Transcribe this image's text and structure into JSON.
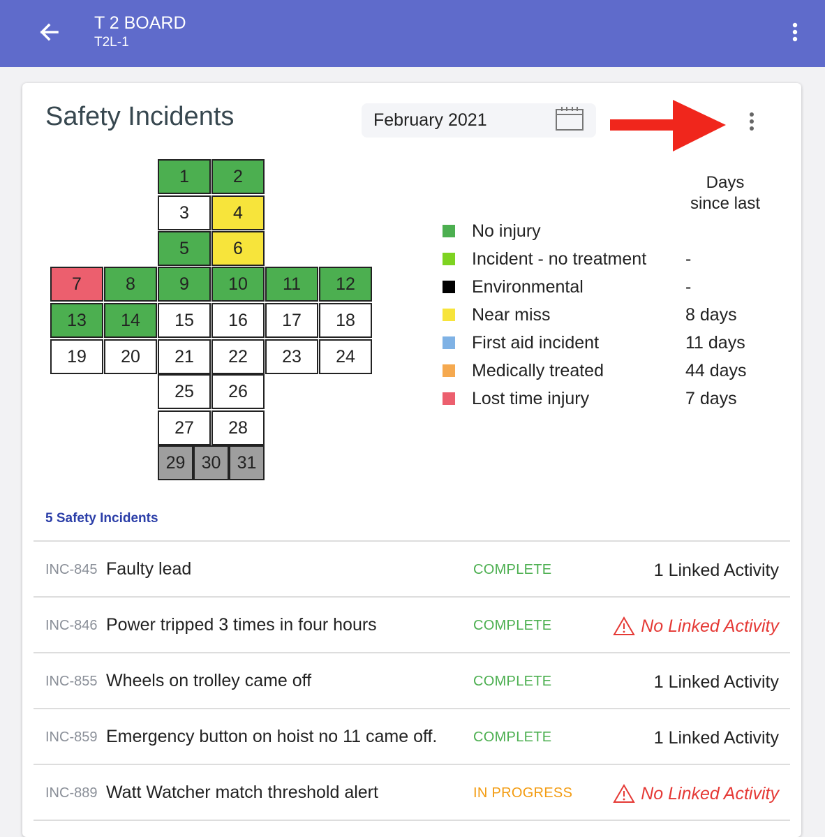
{
  "appbar": {
    "title": "T 2 BOARD",
    "subtitle": "T2L-1"
  },
  "card": {
    "title": "Safety Incidents",
    "date": "February 2021"
  },
  "calendar": {
    "days": [
      {
        "day": "1",
        "category": "no-injury"
      },
      {
        "day": "2",
        "category": "no-injury"
      },
      {
        "day": "3",
        "category": "none"
      },
      {
        "day": "4",
        "category": "near-miss"
      },
      {
        "day": "5",
        "category": "no-injury"
      },
      {
        "day": "6",
        "category": "near-miss"
      },
      {
        "day": "7",
        "category": "lost-time"
      },
      {
        "day": "8",
        "category": "no-injury"
      },
      {
        "day": "9",
        "category": "no-injury"
      },
      {
        "day": "10",
        "category": "no-injury"
      },
      {
        "day": "11",
        "category": "no-injury"
      },
      {
        "day": "12",
        "category": "no-injury"
      },
      {
        "day": "13",
        "category": "no-injury"
      },
      {
        "day": "14",
        "category": "no-injury"
      },
      {
        "day": "15",
        "category": "none"
      },
      {
        "day": "16",
        "category": "none"
      },
      {
        "day": "17",
        "category": "none"
      },
      {
        "day": "18",
        "category": "none"
      },
      {
        "day": "19",
        "category": "none"
      },
      {
        "day": "20",
        "category": "none"
      },
      {
        "day": "21",
        "category": "none"
      },
      {
        "day": "22",
        "category": "none"
      },
      {
        "day": "23",
        "category": "none"
      },
      {
        "day": "24",
        "category": "none"
      },
      {
        "day": "25",
        "category": "none"
      },
      {
        "day": "26",
        "category": "none"
      },
      {
        "day": "27",
        "category": "none"
      },
      {
        "day": "28",
        "category": "none"
      },
      {
        "day": "29",
        "category": "outside-month"
      },
      {
        "day": "30",
        "category": "outside-month"
      },
      {
        "day": "31",
        "category": "outside-month"
      }
    ]
  },
  "legend": {
    "header_line1": "Days",
    "header_line2": "since last",
    "items": [
      {
        "label": "No injury",
        "days": "",
        "color": "#4caf50"
      },
      {
        "label": "Incident - no treatment",
        "days": "-",
        "color": "#7ed321"
      },
      {
        "label": "Environmental",
        "days": "-",
        "color": "#000000"
      },
      {
        "label": "Near miss",
        "days": "8 days",
        "color": "#f7e43b"
      },
      {
        "label": "First aid incident",
        "days": "11 days",
        "color": "#7fb2e5"
      },
      {
        "label": "Medically treated",
        "days": "44 days",
        "color": "#f5a94f"
      },
      {
        "label": "Lost time injury",
        "days": "7 days",
        "color": "#ec5f6e"
      }
    ]
  },
  "incidents": {
    "count_label": "5 Safety Incidents",
    "rows": [
      {
        "id": "INC-845",
        "title": "Faulty lead",
        "status": "COMPLETE",
        "activity": "1 Linked Activity",
        "warning": false
      },
      {
        "id": "INC-846",
        "title": "Power tripped 3 times in four hours",
        "status": "COMPLETE",
        "activity": "No Linked Activity",
        "warning": true
      },
      {
        "id": "INC-855",
        "title": "Wheels on trolley came off",
        "status": "COMPLETE",
        "activity": "1 Linked Activity",
        "warning": false
      },
      {
        "id": "INC-859",
        "title": "Emergency button on hoist no 11 came off.",
        "status": "COMPLETE",
        "activity": "1 Linked Activity",
        "warning": false
      },
      {
        "id": "INC-889",
        "title": "Watt Watcher match threshold alert",
        "status": "IN PROGRESS",
        "activity": "No Linked Activity",
        "warning": true
      }
    ]
  },
  "icons": {
    "back": "arrow-left-icon",
    "menu": "more-vertical-icon",
    "calendar": "calendar-icon",
    "warning": "warning-triangle-icon",
    "annotation": "red-arrow-icon"
  }
}
